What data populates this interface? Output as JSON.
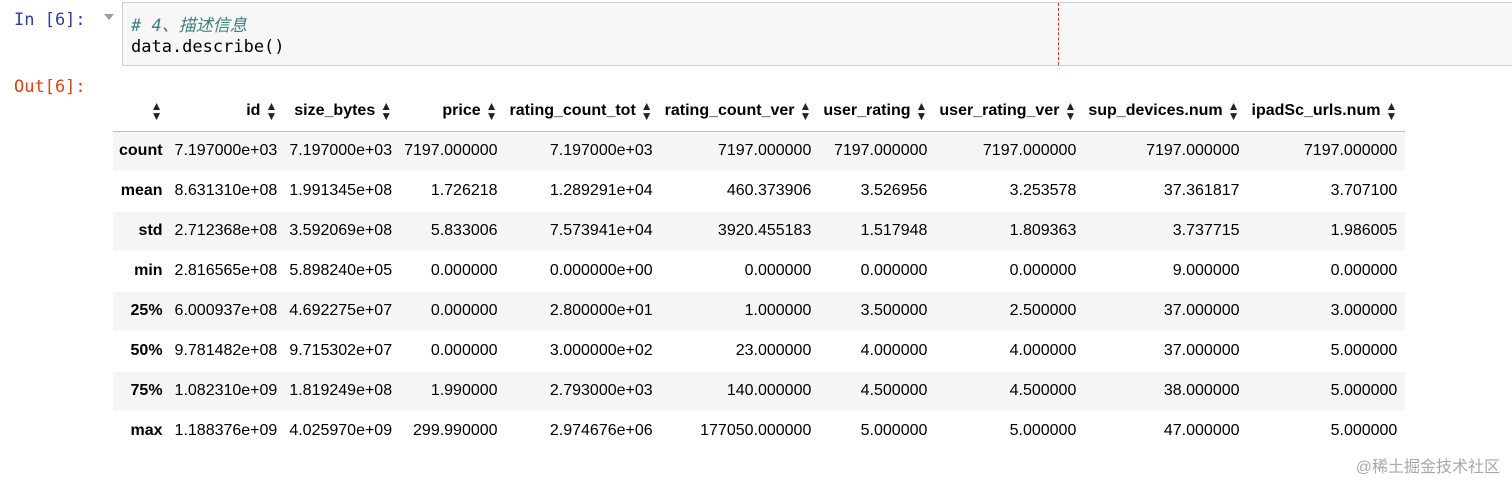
{
  "input_cell": {
    "prompt": "In [6]:",
    "lines": [
      "# 4、描述信息",
      "data.describe()"
    ]
  },
  "output_cell": {
    "prompt": "Out[6]:"
  },
  "table": {
    "columns": [
      "",
      "id",
      "size_bytes",
      "price",
      "rating_count_tot",
      "rating_count_ver",
      "user_rating",
      "user_rating_ver",
      "sup_devices.num",
      "ipadSc_urls.num"
    ],
    "rows": [
      {
        "label": "count",
        "values": [
          "7.197000e+03",
          "7.197000e+03",
          "7197.000000",
          "7.197000e+03",
          "7197.000000",
          "7197.000000",
          "7197.000000",
          "7197.000000",
          "7197.000000"
        ]
      },
      {
        "label": "mean",
        "values": [
          "8.631310e+08",
          "1.991345e+08",
          "1.726218",
          "1.289291e+04",
          "460.373906",
          "3.526956",
          "3.253578",
          "37.361817",
          "3.707100"
        ]
      },
      {
        "label": "std",
        "values": [
          "2.712368e+08",
          "3.592069e+08",
          "5.833006",
          "7.573941e+04",
          "3920.455183",
          "1.517948",
          "1.809363",
          "3.737715",
          "1.986005"
        ]
      },
      {
        "label": "min",
        "values": [
          "2.816565e+08",
          "5.898240e+05",
          "0.000000",
          "0.000000e+00",
          "0.000000",
          "0.000000",
          "0.000000",
          "9.000000",
          "0.000000"
        ]
      },
      {
        "label": "25%",
        "values": [
          "6.000937e+08",
          "4.692275e+07",
          "0.000000",
          "2.800000e+01",
          "1.000000",
          "3.500000",
          "2.500000",
          "37.000000",
          "3.000000"
        ]
      },
      {
        "label": "50%",
        "values": [
          "9.781482e+08",
          "9.715302e+07",
          "0.000000",
          "3.000000e+02",
          "23.000000",
          "4.000000",
          "4.000000",
          "37.000000",
          "5.000000"
        ]
      },
      {
        "label": "75%",
        "values": [
          "1.082310e+09",
          "1.819249e+08",
          "1.990000",
          "2.793000e+03",
          "140.000000",
          "4.500000",
          "4.500000",
          "38.000000",
          "5.000000"
        ]
      },
      {
        "label": "max",
        "values": [
          "1.188376e+09",
          "4.025970e+09",
          "299.990000",
          "2.974676e+06",
          "177050.000000",
          "5.000000",
          "5.000000",
          "47.000000",
          "5.000000"
        ]
      }
    ]
  },
  "icons": {
    "sort": "sort-up-down-icon",
    "collapse": "collapse-arrow-icon"
  },
  "watermark": "@稀土掘金技术社区"
}
